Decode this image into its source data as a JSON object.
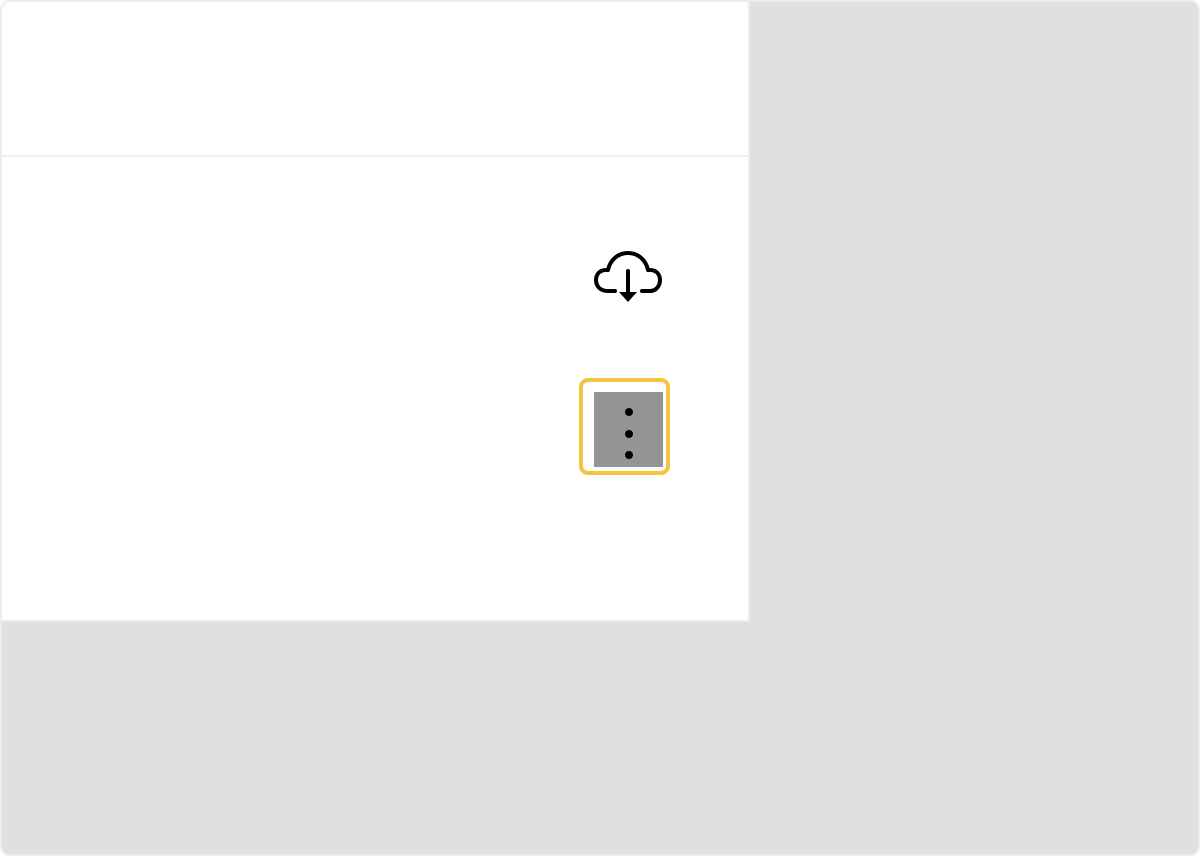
{
  "toolbar": {
    "download": {
      "icon": "cloud-download-icon"
    },
    "more_options": {
      "icon": "more-vertical-icon",
      "highlighted": true,
      "highlight_color": "#f5c542",
      "background_color": "#949494"
    }
  },
  "colors": {
    "page_background": "#e0e0e0",
    "panel_background": "#ffffff",
    "divider": "#eeeeee"
  }
}
